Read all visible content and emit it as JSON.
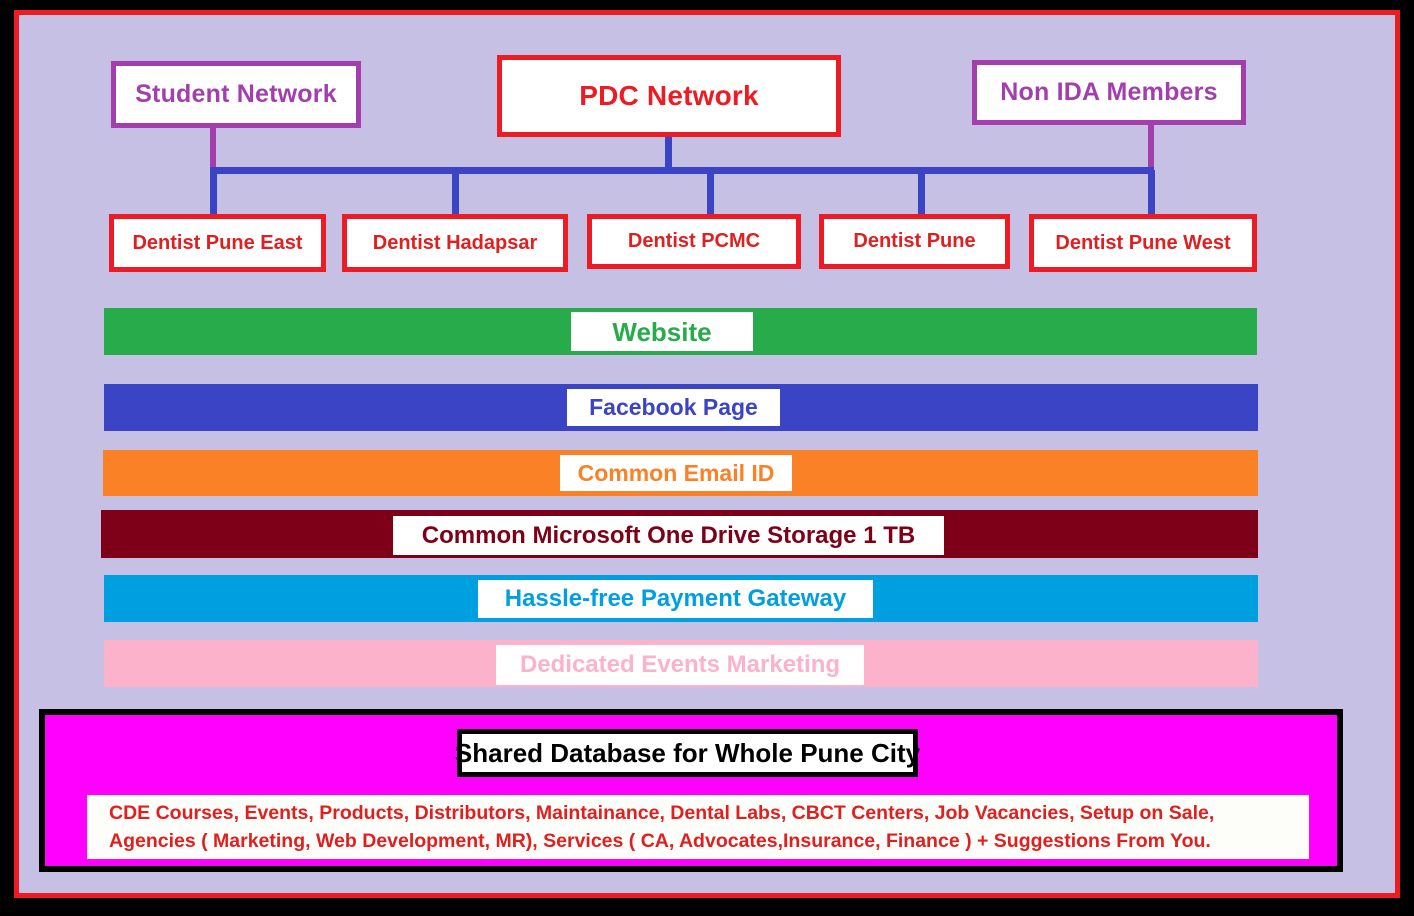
{
  "diagram": {
    "background_color": "#c6c0e4",
    "frame_border_color": "#ed1c24",
    "page_color": "#000000"
  },
  "tier1": [
    {
      "label": "Student Network",
      "color": "#a23fad"
    },
    {
      "label": "PDC Network",
      "color": "#ed1c24"
    },
    {
      "label": "Non IDA Members",
      "color": "#a23fad"
    }
  ],
  "tier2": [
    {
      "label": "Dentist Pune East"
    },
    {
      "label": "Dentist Hadapsar"
    },
    {
      "label": "Dentist PCMC"
    },
    {
      "label": "Dentist Pune"
    },
    {
      "label": "Dentist Pune West"
    }
  ],
  "connectors": {
    "trunk_color": "#3b44c4",
    "student_branch_color": "#a23fad",
    "nonida_branch_color": "#a23fad",
    "pdc_branch_color": "#3b44c4"
  },
  "bars": [
    {
      "label": "Website",
      "bar_color": "#27ab4b",
      "text_color": "#27ab4b"
    },
    {
      "label": "Facebook Page",
      "bar_color": "#3b44c4",
      "text_color": "#3b44c4"
    },
    {
      "label": "Common Email ID",
      "bar_color": "#fb8127",
      "text_color": "#fb8127"
    },
    {
      "label": "Common Microsoft One Drive Storage 1 TB",
      "bar_color": "#7e0018",
      "text_color": "#7e0018"
    },
    {
      "label": "Hassle-free Payment Gateway",
      "bar_color": "#00a0e0",
      "text_color": "#00a0e0"
    },
    {
      "label": "Dedicated Events Marketing",
      "bar_color": "#fcb2ca",
      "text_color": "#fcb2ca"
    }
  ],
  "shared": {
    "panel_color": "#ff00ff",
    "title": "Shared Database for Whole Pune City",
    "line1": "CDE Courses, Events, Products, Distributors, Maintainance, Dental Labs, CBCT Centers, Job Vacancies, Setup on Sale,",
    "line2": "Agencies ( Marketing, Web Development, MR), Services ( CA, Advocates,Insurance, Finance ) + Suggestions From You."
  }
}
